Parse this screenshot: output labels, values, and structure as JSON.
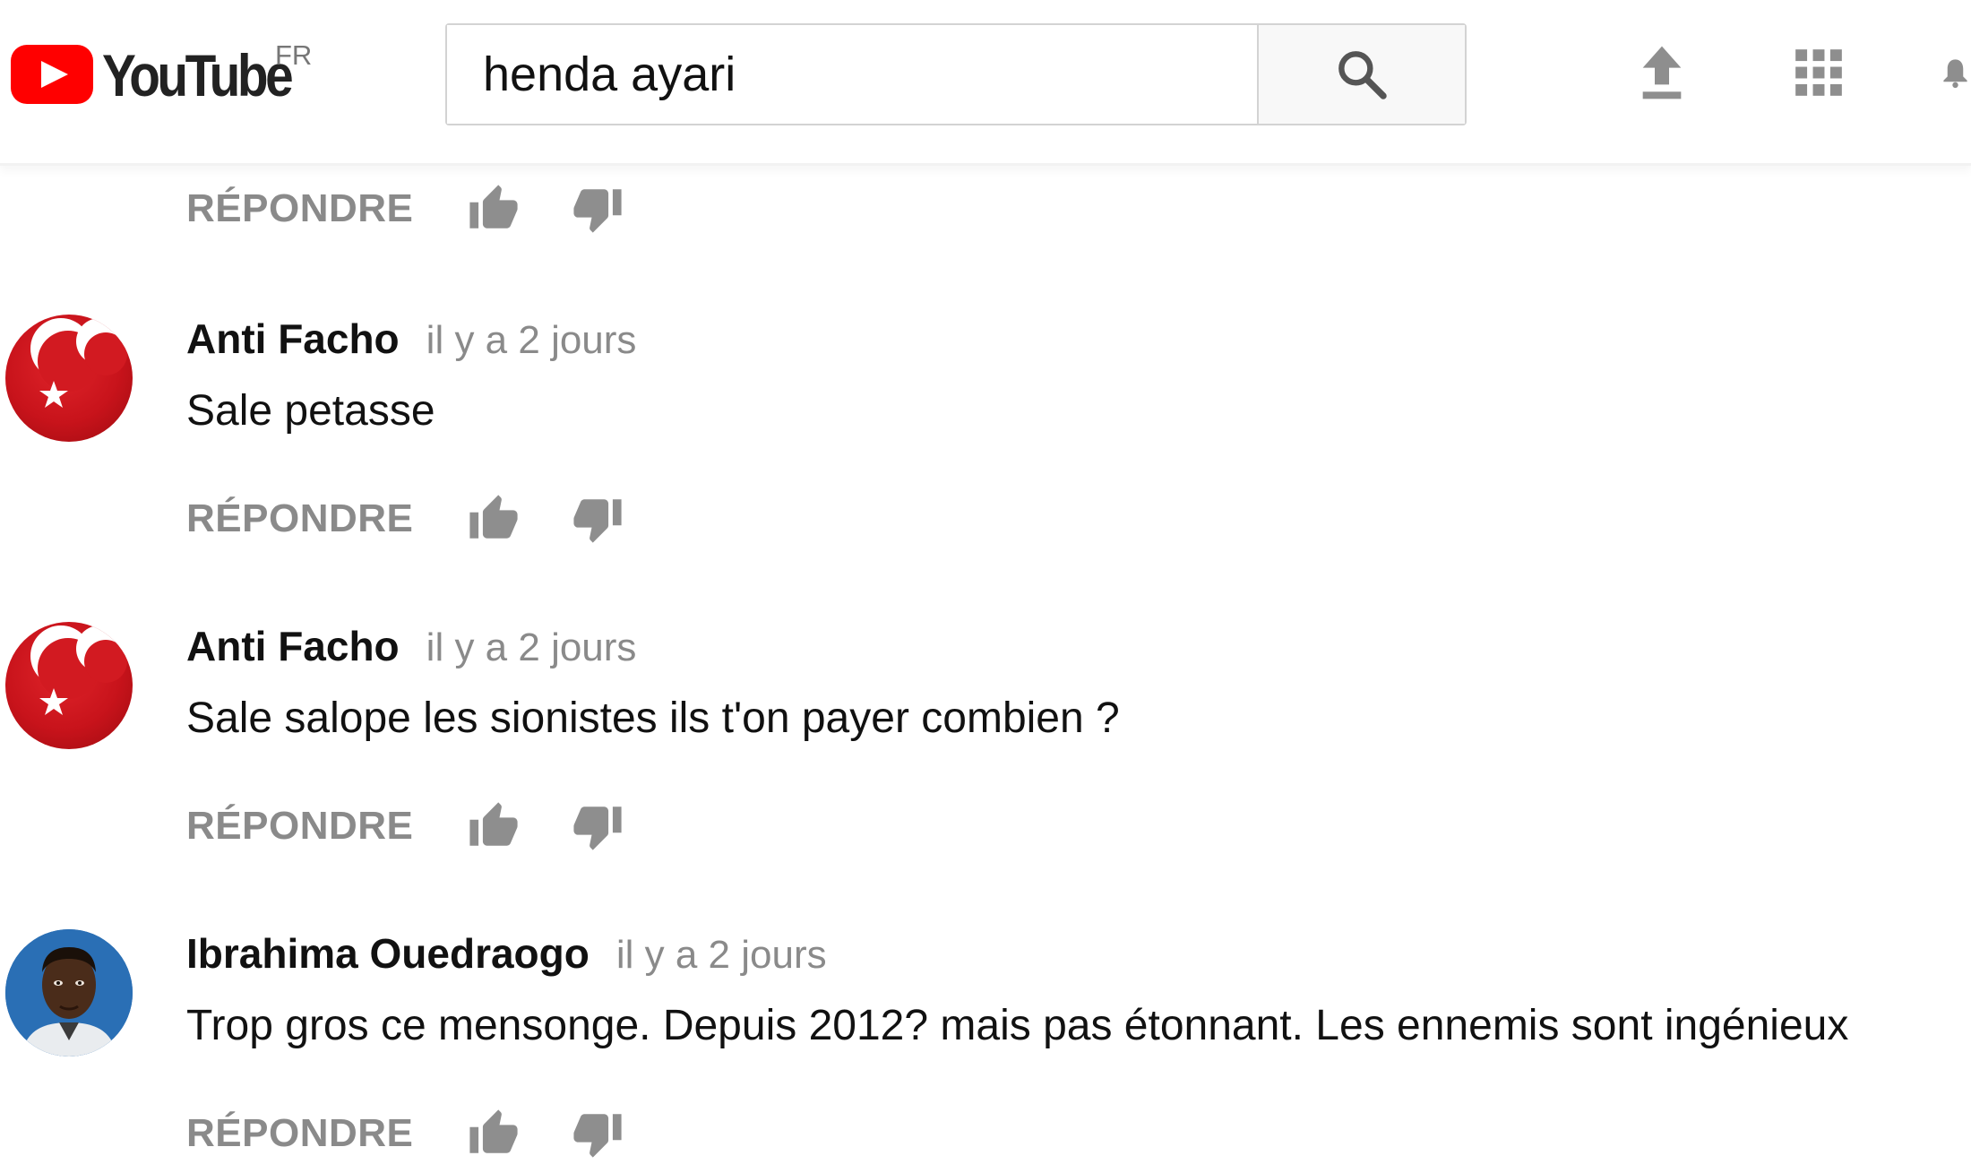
{
  "header": {
    "logo_text": "YouTube",
    "region": "FR",
    "search_value": "henda ayari",
    "brand_color": "#ff0000",
    "icons": [
      "upload-icon",
      "apps-grid-icon",
      "notifications-bell-icon",
      "search-icon"
    ]
  },
  "labels": {
    "reply": "RÉPONDRE"
  },
  "comments": [
    {
      "author": "Anti Facho",
      "time": "il y a 2 jours",
      "text": "Sale petasse",
      "avatar": "flag-avatar"
    },
    {
      "author": "Anti Facho",
      "time": "il y a 2 jours",
      "text": "Sale salope les sionistes ils t'on payer combien ?",
      "avatar": "flag-avatar"
    },
    {
      "author": "Ibrahima Ouedraogo",
      "time": "il y a 2 jours",
      "text": "Trop gros ce mensonge. Depuis 2012? mais pas étonnant. Les ennemis sont ingénieux",
      "avatar": "photo-avatar"
    }
  ]
}
